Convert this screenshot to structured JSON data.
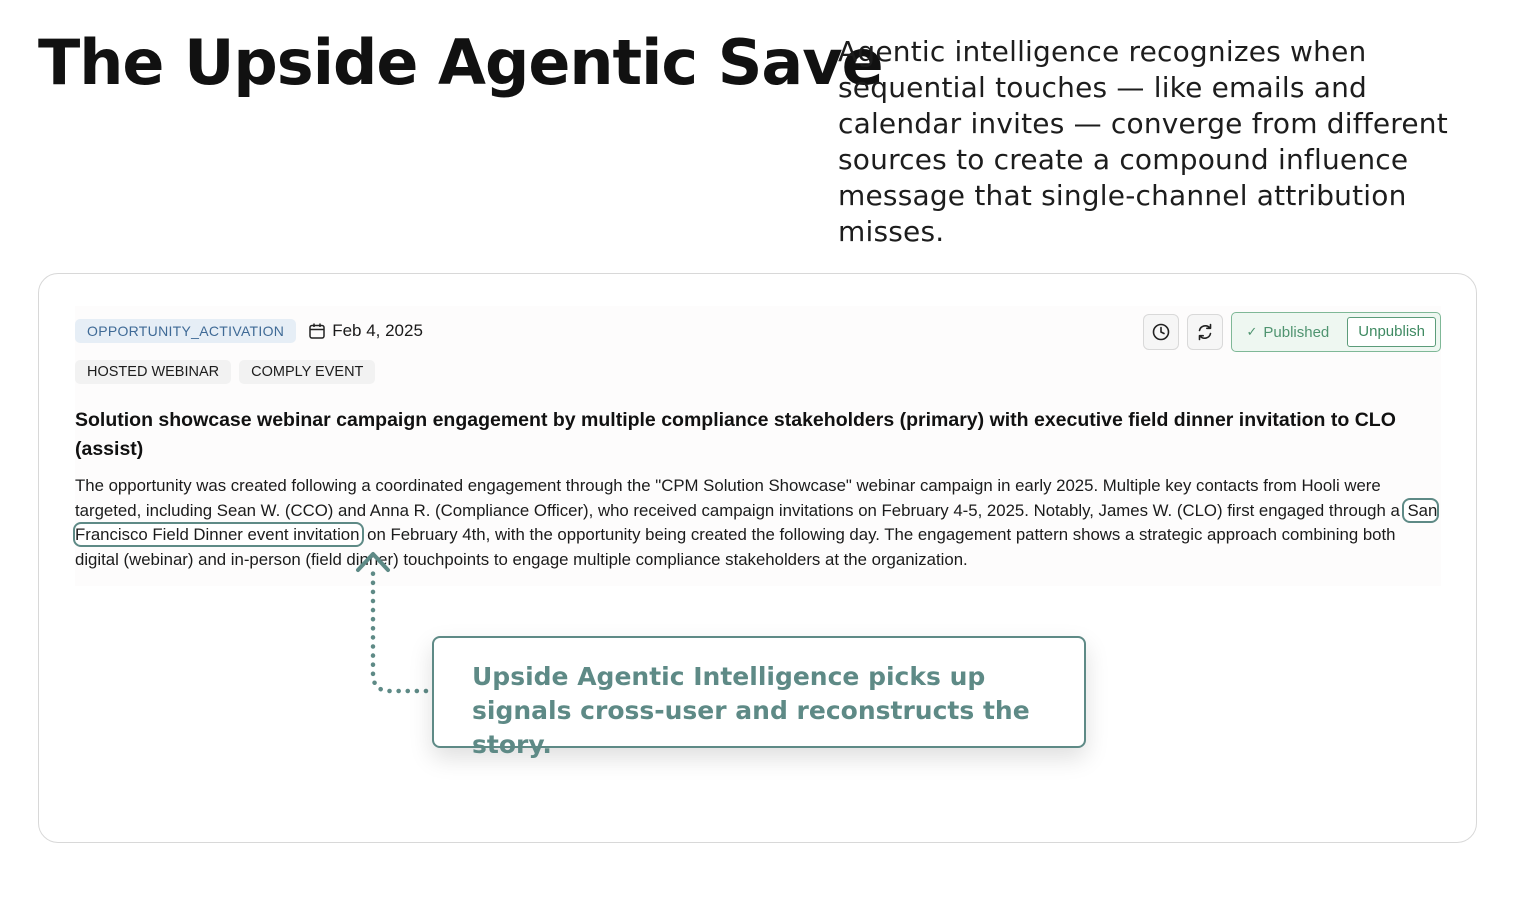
{
  "hero": {
    "title": "The Upside Agentic Save",
    "description": "Agentic intelligence recognizes when sequential touches — like emails and calendar invites — converge from different sources to create a compound influence message that single-channel attribution misses."
  },
  "record": {
    "category_chip": "OPPORTUNITY_ACTIVATION",
    "date": "Feb 4, 2025",
    "actions": {
      "status_label": "Published",
      "unpublish_label": "Unpublish"
    },
    "tags": [
      "HOSTED WEBINAR",
      "COMPLY EVENT"
    ],
    "headline": "Solution showcase webinar campaign engagement by multiple compliance stakeholders (primary) with executive field dinner invitation to CLO (assist)",
    "body": {
      "before_highlight": "The opportunity was created following a coordinated engagement through the \"CPM Solution Showcase\" webinar campaign in early 2025. Multiple key contacts from Hooli were targeted, including Sean W. (CCO) and Anna R. (Compliance Officer), who received campaign invitations on February 4-5, 2025. Notably, James W. (CLO) first engaged through a ",
      "highlight": "San Francisco Field Dinner event invitation",
      "after_highlight": " on February 4th, with the opportunity being created the following day. The engagement pattern shows a strategic approach combining both digital (webinar) and in-person (field dinner) touchpoints to engage multiple compliance stakeholders at the organization."
    }
  },
  "callout": {
    "text": "Upside Agentic Intelligence picks up signals cross-user and reconstructs the story."
  },
  "colors": {
    "accent": "#5e8a86",
    "chip_bg": "#e6eef6",
    "chip_text": "#3f6a96",
    "published_green": "#4f9470"
  },
  "icons": [
    "calendar-icon",
    "clock-icon",
    "refresh-icon",
    "check-icon"
  ]
}
